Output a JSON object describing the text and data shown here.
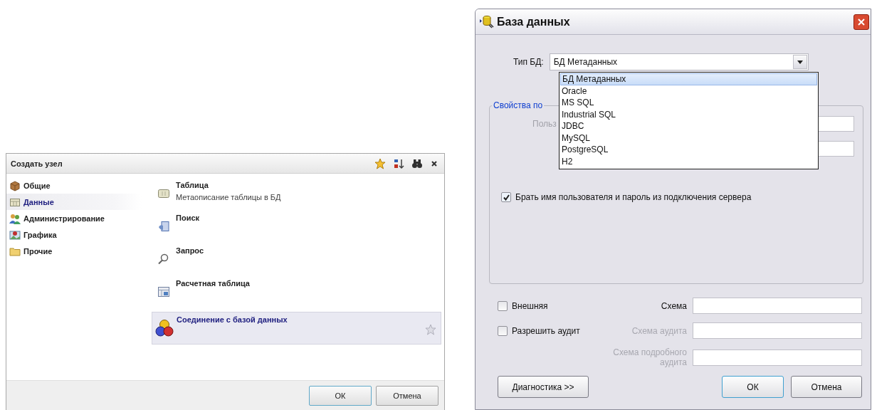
{
  "create_node": {
    "title": "Создать узел",
    "categories": [
      {
        "label": "Общие",
        "kind": "package",
        "selected": false
      },
      {
        "label": "Данные",
        "kind": "data",
        "selected": true
      },
      {
        "label": "Администрирование",
        "kind": "people",
        "selected": false
      },
      {
        "label": "Графика",
        "kind": "picture",
        "selected": false
      },
      {
        "label": "Прочие",
        "kind": "folder",
        "selected": false
      }
    ],
    "items": [
      {
        "title": "Таблица",
        "description": "Метаописание таблицы в БД",
        "kind": "table",
        "selected": false
      },
      {
        "title": "Поиск",
        "kind": "search",
        "selected": false
      },
      {
        "title": "Запрос",
        "kind": "query",
        "selected": false
      },
      {
        "title": "Расчетная таблица",
        "kind": "calc",
        "selected": false
      },
      {
        "title": "Соединение с базой данных",
        "kind": "connection",
        "selected": true
      }
    ],
    "buttons": [
      {
        "label": "ОК",
        "default": true
      },
      {
        "label": "Отмена",
        "default": false
      }
    ]
  },
  "db_dialog": {
    "title": "База данных",
    "db_type_label": "Тип БД:",
    "db_type_value": "БД Метаданных",
    "dropdown_options": [
      {
        "label": "БД Метаданных",
        "selected": true
      },
      {
        "label": "Oracle",
        "selected": false
      },
      {
        "label": "MS SQL",
        "selected": false
      },
      {
        "label": "Industrial SQL",
        "selected": false
      },
      {
        "label": "JDBC",
        "selected": false
      },
      {
        "label": "MySQL",
        "selected": false
      },
      {
        "label": "PostgreSQL",
        "selected": false
      },
      {
        "label": "H2",
        "selected": false
      }
    ],
    "group_title": "Свойства по",
    "user_label": "Польз",
    "use_server_credentials": {
      "label": "Брать имя пользователя и пароль из подключения сервера",
      "checked": true
    },
    "schema_rows": [
      {
        "checkbox": {
          "label": "Внешняя",
          "checked": false
        },
        "label": "Схема",
        "disabled": false
      },
      {
        "checkbox": {
          "label": "Разрешить аудит",
          "checked": false
        },
        "label": "Схема аудита",
        "disabled": true
      },
      {
        "label": "Схема подробного аудита",
        "disabled": true
      }
    ],
    "buttons": [
      {
        "label": "Диагностика >>",
        "default": false
      },
      {
        "label": "ОК",
        "default": true
      },
      {
        "label": "Отмена",
        "default": false
      }
    ]
  }
}
